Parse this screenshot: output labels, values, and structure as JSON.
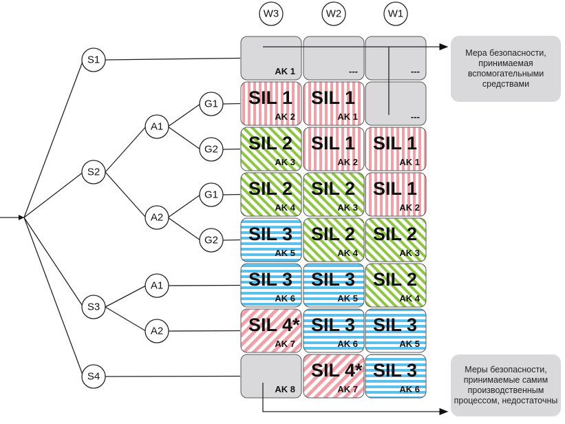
{
  "columns": [
    "W3",
    "W2",
    "W1"
  ],
  "tree": {
    "s": [
      "S1",
      "S2",
      "S3",
      "S4"
    ],
    "a": [
      "A1",
      "A2",
      "A1",
      "A2"
    ],
    "g": [
      "G1",
      "G2",
      "G1",
      "G2"
    ]
  },
  "colors": {
    "sil1": "#f2a0a8",
    "sil2": "#8dc63f",
    "sil3": "#5bc0eb",
    "sil4": "#f2a0a8",
    "none": "#d9d9dc"
  },
  "rows": [
    [
      {
        "sil": "",
        "ak": "AK 1",
        "p": "none"
      },
      {
        "sil": "",
        "ak": "---",
        "p": "none"
      },
      {
        "sil": "",
        "ak": "---",
        "p": "none"
      }
    ],
    [
      {
        "sil": "SIL 1",
        "ak": "AK 2",
        "p": "sil1"
      },
      {
        "sil": "SIL 1",
        "ak": "AK 1",
        "p": "sil1"
      },
      {
        "sil": "",
        "ak": "---",
        "p": "none"
      }
    ],
    [
      {
        "sil": "SIL 2",
        "ak": "AK 3",
        "p": "sil2"
      },
      {
        "sil": "SIL 1",
        "ak": "AK 2",
        "p": "sil1"
      },
      {
        "sil": "SIL 1",
        "ak": "AK 1",
        "p": "sil1"
      }
    ],
    [
      {
        "sil": "SIL 2",
        "ak": "AK 4",
        "p": "sil2"
      },
      {
        "sil": "SIL 2",
        "ak": "AK 3",
        "p": "sil2"
      },
      {
        "sil": "SIL 1",
        "ak": "AK 2",
        "p": "sil1"
      }
    ],
    [
      {
        "sil": "SIL 3",
        "ak": "AK 5",
        "p": "sil3"
      },
      {
        "sil": "SIL 2",
        "ak": "AK 4",
        "p": "sil2"
      },
      {
        "sil": "SIL 2",
        "ak": "AK 3",
        "p": "sil2"
      }
    ],
    [
      {
        "sil": "SIL 3",
        "ak": "AK 6",
        "p": "sil3"
      },
      {
        "sil": "SIL 3",
        "ak": "AK 5",
        "p": "sil3"
      },
      {
        "sil": "SIL 2",
        "ak": "AK 4",
        "p": "sil2"
      }
    ],
    [
      {
        "sil": "SIL 4*",
        "ak": "AK 7",
        "p": "sil4"
      },
      {
        "sil": "SIL 3",
        "ak": "AK 6",
        "p": "sil3"
      },
      {
        "sil": "SIL 3",
        "ak": "AK 5",
        "p": "sil3"
      }
    ],
    [
      {
        "sil": "",
        "ak": "AK 8",
        "p": "none"
      },
      {
        "sil": "SIL 4*",
        "ak": "AK 7",
        "p": "sil4"
      },
      {
        "sil": "SIL 3",
        "ak": "AK 6",
        "p": "sil3"
      }
    ]
  ],
  "callouts": {
    "top": "Мера безопасности, принимаемая вспомогательными средствами",
    "bottom": "Меры безопасности, принимаемые самим производственным процессом, недостаточны"
  }
}
